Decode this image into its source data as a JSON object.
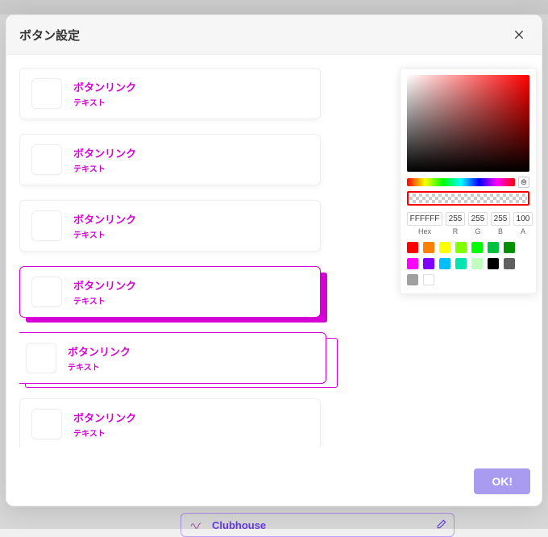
{
  "modal": {
    "title": "ボタン設定",
    "ok_label": "OK!"
  },
  "list": {
    "item_title": "ボタンリンク",
    "item_subtitle": "テキスト"
  },
  "picker": {
    "hex": "FFFFFF",
    "r": "255",
    "g": "255",
    "b": "255",
    "a": "100",
    "labels": {
      "hex": "Hex",
      "r": "R",
      "g": "G",
      "b": "B",
      "a": "A"
    },
    "swatches": [
      "#ff0000",
      "#ff8000",
      "#ffff00",
      "#80ff00",
      "#00ff00",
      "#00c040",
      "#009000",
      "#ff00ff",
      "#8000ff",
      "#00bfff",
      "#00e5b0",
      "#c0ffc0",
      "#000000",
      "#606060",
      "#a0a0a0",
      "#ffffff"
    ]
  },
  "bg_item": {
    "label": "Clubhouse"
  }
}
